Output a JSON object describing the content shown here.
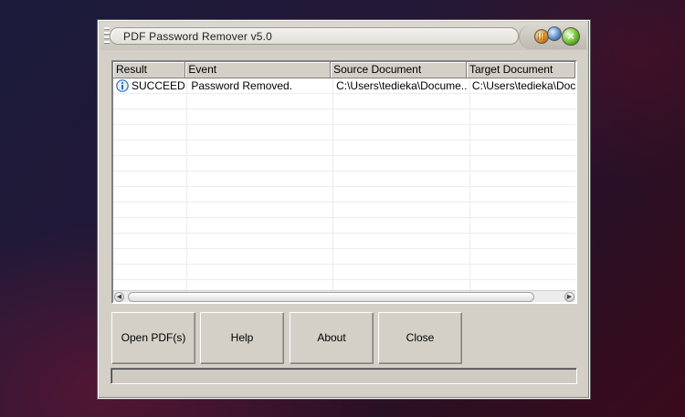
{
  "window": {
    "title": "PDF Password Remover v5.0"
  },
  "list": {
    "columns": [
      "Result",
      "Event",
      "Source Document",
      "Target Document"
    ],
    "rows": [
      {
        "result": "SUCCEED",
        "event": "Password Removed.",
        "source": "C:\\Users\\tedieka\\Docume...",
        "target": "C:\\Users\\tedieka\\Docu"
      }
    ]
  },
  "buttons": {
    "open": "Open PDF(s)",
    "help": "Help",
    "about": "About",
    "close": "Close"
  },
  "colors": {
    "window_bg": "#d4d0c8",
    "info_icon": "#2a6fb8"
  },
  "icons": {
    "result_status": "info-icon",
    "window_controls": [
      "minimize-icon",
      "maximize-icon",
      "close-icon"
    ]
  }
}
